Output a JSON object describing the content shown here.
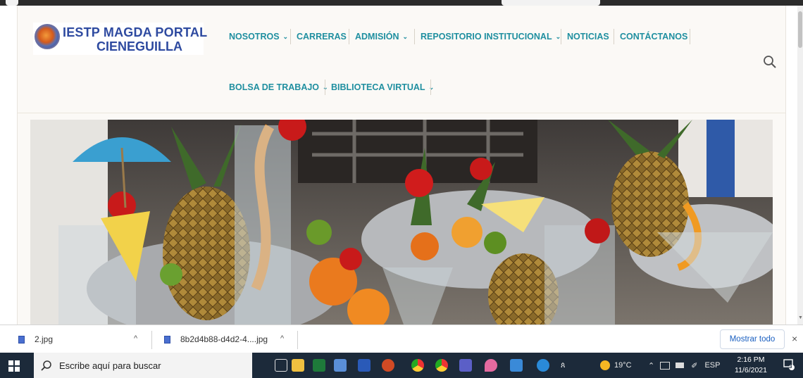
{
  "site": {
    "logo_line1": "IESTP MAGDA PORTAL",
    "logo_line2": "CIENEGUILLA",
    "nav_row1": [
      {
        "label": "NOSOTROS",
        "has_dropdown": true
      },
      {
        "label": "CARRERAS",
        "has_dropdown": false
      },
      {
        "label": "ADMISIÓN",
        "has_dropdown": true
      },
      {
        "label": "REPOSITORIO INSTITUCIONAL",
        "has_dropdown": true
      },
      {
        "label": "NOTICIAS",
        "has_dropdown": false
      },
      {
        "label": "CONTÁCTANOS",
        "has_dropdown": false
      }
    ],
    "nav_row2": [
      {
        "label": "BOLSA DE TRABAJO",
        "has_dropdown": true
      },
      {
        "label": "BIBLIOTECA VIRTUAL",
        "has_dropdown": true
      }
    ],
    "dropdown_glyph": "⌄",
    "search_icon": "magnifier-icon",
    "nav_color": "#1f8fa0",
    "logo_color": "#2e4aa0"
  },
  "downloads": {
    "items": [
      {
        "name": "2.jpg"
      },
      {
        "name": "8b2d4b88-d4d2-4....jpg"
      }
    ],
    "show_all_label": "Mostrar todo",
    "caret": "^",
    "close": "×"
  },
  "taskbar": {
    "search_placeholder": "Escribe aquí para buscar",
    "weather": "19°C",
    "language": "ESP",
    "time": "2:16 PM",
    "date": "11/6/2021",
    "notification_count": "3"
  }
}
